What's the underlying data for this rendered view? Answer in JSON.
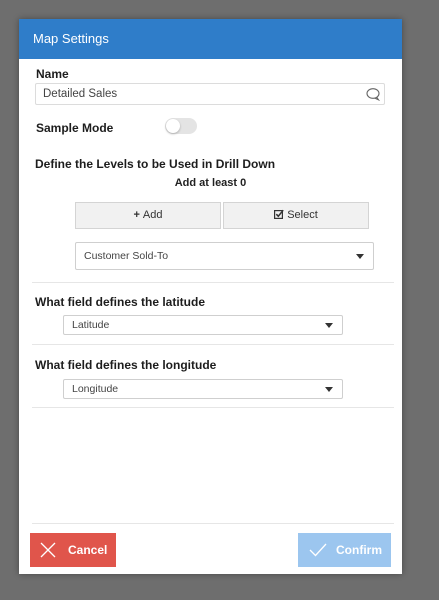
{
  "dialog": {
    "title": "Map Settings"
  },
  "name": {
    "label": "Name",
    "value": "Detailed Sales"
  },
  "sample_mode": {
    "label": "Sample Mode",
    "enabled": false
  },
  "levels": {
    "label": "Define the Levels to be Used in Drill Down",
    "hint": "Add at least 0",
    "add_label": "Add",
    "select_label": "Select",
    "selected_level": "Customer Sold-To"
  },
  "latitude": {
    "label": "What field defines the latitude",
    "value": "Latitude"
  },
  "longitude": {
    "label": "What field defines the longitude",
    "value": "Longitude"
  },
  "footer": {
    "cancel_label": "Cancel",
    "confirm_label": "Confirm"
  },
  "colors": {
    "header": "#2f7dc9",
    "cancel": "#e0554b",
    "confirm": "#9cc6ef"
  }
}
